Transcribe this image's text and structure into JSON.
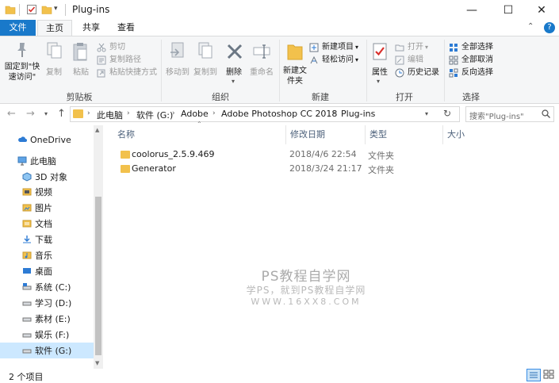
{
  "window": {
    "title": "Plug-ins",
    "minimize_glyph": "—",
    "maximize_glyph": "☐",
    "close_glyph": "✕"
  },
  "ribbon_tabs": [
    "文件",
    "主页",
    "共享",
    "查看"
  ],
  "ribbon": {
    "clipboard": {
      "label": "剪贴板",
      "pin": "固定到\"快速访问\"",
      "copy": "复制",
      "paste": "粘贴",
      "cut": "剪切",
      "copy_path": "复制路径",
      "paste_shortcut": "粘贴快捷方式"
    },
    "organize": {
      "label": "组织",
      "move_to": "移动到",
      "copy_to": "复制到",
      "delete": "删除",
      "rename": "重命名"
    },
    "new": {
      "label": "新建",
      "new_folder": "新建文件夹",
      "new_item": "新建项目",
      "easy_access": "轻松访问"
    },
    "open": {
      "label": "打开",
      "properties": "属性",
      "open": "打开",
      "edit": "编辑",
      "history": "历史记录"
    },
    "select": {
      "label": "选择",
      "select_all": "全部选择",
      "select_none": "全部取消",
      "invert": "反向选择"
    }
  },
  "address": {
    "crumbs": [
      "此电脑",
      "软件 (G:)",
      "Adobe",
      "Adobe Photoshop CC 2018",
      "Plug-ins"
    ],
    "search_placeholder": "搜索\"Plug-ins\""
  },
  "nav": [
    {
      "label": "OneDrive",
      "icon": "cloud-icon"
    },
    {
      "label": "此电脑",
      "icon": "computer-icon"
    },
    {
      "label": "3D 对象",
      "icon": "cube-icon"
    },
    {
      "label": "视频",
      "icon": "video-icon"
    },
    {
      "label": "图片",
      "icon": "picture-icon"
    },
    {
      "label": "文档",
      "icon": "document-icon"
    },
    {
      "label": "下载",
      "icon": "download-icon"
    },
    {
      "label": "音乐",
      "icon": "music-icon"
    },
    {
      "label": "桌面",
      "icon": "desktop-icon"
    },
    {
      "label": "系统 (C:)",
      "icon": "drive-icon"
    },
    {
      "label": "学习 (D:)",
      "icon": "drive-icon"
    },
    {
      "label": "素材 (E:)",
      "icon": "drive-icon"
    },
    {
      "label": "娱乐 (F:)",
      "icon": "drive-icon"
    },
    {
      "label": "软件 (G:)",
      "icon": "drive-icon"
    }
  ],
  "columns": [
    "名称",
    "修改日期",
    "类型",
    "大小"
  ],
  "files": [
    {
      "name": "coolorus_2.5.9.469",
      "modified": "2018/4/6 22:54",
      "type": "文件夹",
      "size": ""
    },
    {
      "name": "Generator",
      "modified": "2018/3/24 21:17",
      "type": "文件夹",
      "size": ""
    }
  ],
  "status": {
    "count": "2 个项目"
  },
  "watermark": {
    "line1": "PS教程自学网",
    "line2": "学PS，就到PS教程自学网",
    "line3": "WWW.16XX8.COM"
  },
  "colors": {
    "accent": "#1979ca",
    "folder": "#f2c14c",
    "selection": "#cce8ff"
  }
}
